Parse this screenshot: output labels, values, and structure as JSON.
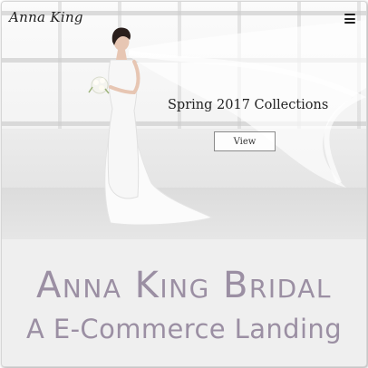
{
  "header": {
    "logo": "Anna King",
    "menu_icon": "hamburger-menu-icon"
  },
  "hero": {
    "title": "Spring 2017 Collections",
    "button_label": "View",
    "image_description_icon": "bride-photo"
  },
  "brand": {
    "name": "Anna King Bridal",
    "subtitle": "A E-Commerce Landing",
    "color": "#9b8fa3"
  }
}
